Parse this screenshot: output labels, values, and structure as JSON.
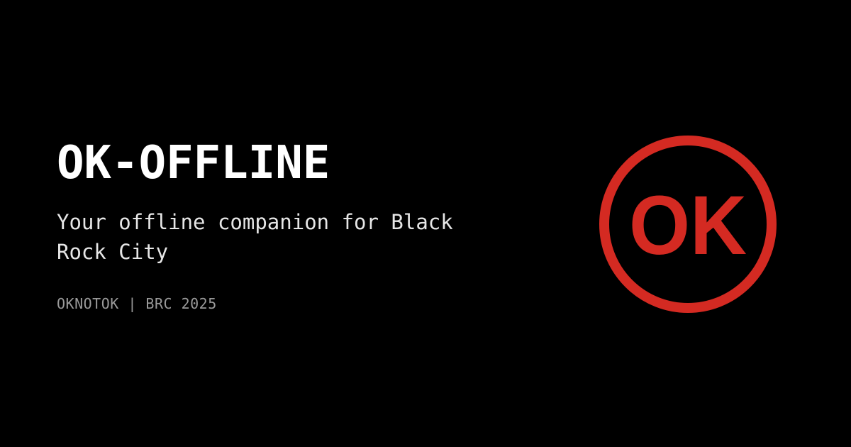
{
  "card": {
    "title": "OK-OFFLINE",
    "tagline": "Your offline companion for Black Rock City",
    "meta": "OKNOTOK | BRC 2025"
  },
  "logo": {
    "icon": "ok-circle-logo-icon",
    "text": "OK",
    "color": "#D42A22"
  },
  "colors": {
    "background": "#000000",
    "title": "#FFFFFF",
    "tagline": "#E6E6E6",
    "meta": "#9A9A9A"
  }
}
